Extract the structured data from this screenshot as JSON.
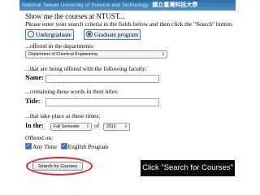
{
  "banner": {
    "university_en": "National Taiwan University of Science and Technology",
    "university_zh": "國立臺灣科技大學"
  },
  "form": {
    "heading": "Show me the courses at NTUST...",
    "instructions": "Please enter your search criteria in the fields below and then click the \"Search\" button.",
    "program_options": [
      {
        "label": "Undergraduate",
        "selected": false
      },
      {
        "label": "Graduate program",
        "selected": true
      }
    ],
    "departments_label": "...offered in the departments:",
    "department_selected": "Department of Chemical Engineering",
    "faculty_label": "...that are being offered with the following faculty:",
    "name_label": "Name:",
    "name_value": "",
    "words_label": "...containing these words in their titles:",
    "title_label": "Title:",
    "title_value": "",
    "times_label": "...that take place at these times:",
    "in_the_label": "In the:",
    "semester_selected": "Fall Semester",
    "of_label": "of",
    "year_selected": "2013",
    "offered_on_label": "Offered on:",
    "options": [
      {
        "label": "Any Time",
        "checked": true
      },
      {
        "label": "English Program",
        "checked": true
      }
    ],
    "search_button_label": "Search for Courses"
  },
  "callout": {
    "text": "Click \"Search for Courses\""
  },
  "colors": {
    "banner": "#3a80b8",
    "highlight": "#e0242a",
    "callout_bg": "#0a0a0a",
    "accent": "#2a62b8"
  }
}
